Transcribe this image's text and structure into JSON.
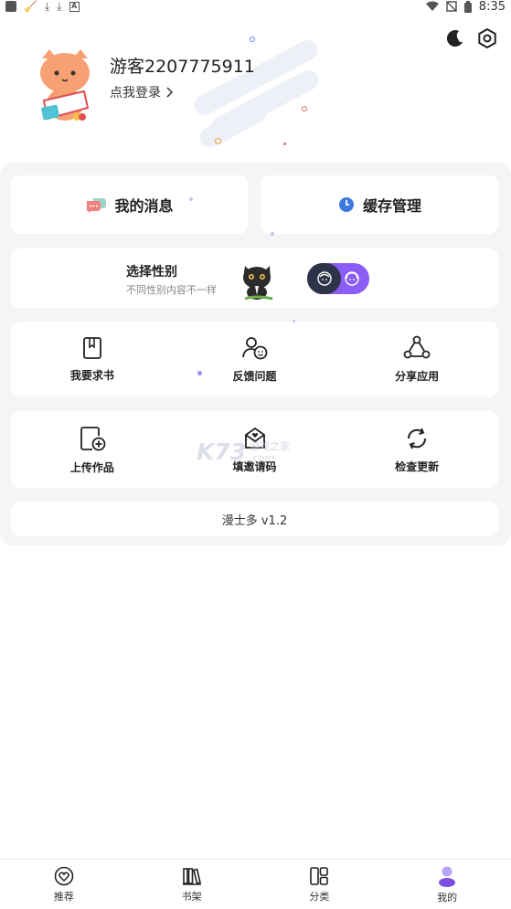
{
  "status_bar": {
    "time": "8:35"
  },
  "profile": {
    "username": "游客2207775911",
    "login_prompt": "点我登录"
  },
  "actions": {
    "messages_label": "我的消息",
    "cache_label": "缓存管理"
  },
  "gender": {
    "title": "选择性别",
    "subtitle": "不同性别内容不一样"
  },
  "grid_row1": [
    {
      "label": "我要求书",
      "icon": "book-icon"
    },
    {
      "label": "反馈问题",
      "icon": "feedback-icon"
    },
    {
      "label": "分享应用",
      "icon": "share-icon"
    }
  ],
  "grid_row2": [
    {
      "label": "上传作品",
      "icon": "upload-icon"
    },
    {
      "label": "填邀请码",
      "icon": "invite-code-icon"
    },
    {
      "label": "检查更新",
      "icon": "refresh-icon"
    }
  ],
  "version": "漫士多  v1.2",
  "watermark": {
    "logo": "K73",
    "text": "游戏之家",
    "sub": ".com"
  },
  "bottom_nav": [
    {
      "label": "推荐",
      "icon": "heart-icon"
    },
    {
      "label": "书架",
      "icon": "bookshelf-icon"
    },
    {
      "label": "分类",
      "icon": "category-icon"
    },
    {
      "label": "我的",
      "icon": "profile-icon",
      "active": true
    }
  ],
  "colors": {
    "accent_purple": "#8b5cf6",
    "panel_bg": "#f5f5f7",
    "toggle_dark": "#2e3447"
  }
}
